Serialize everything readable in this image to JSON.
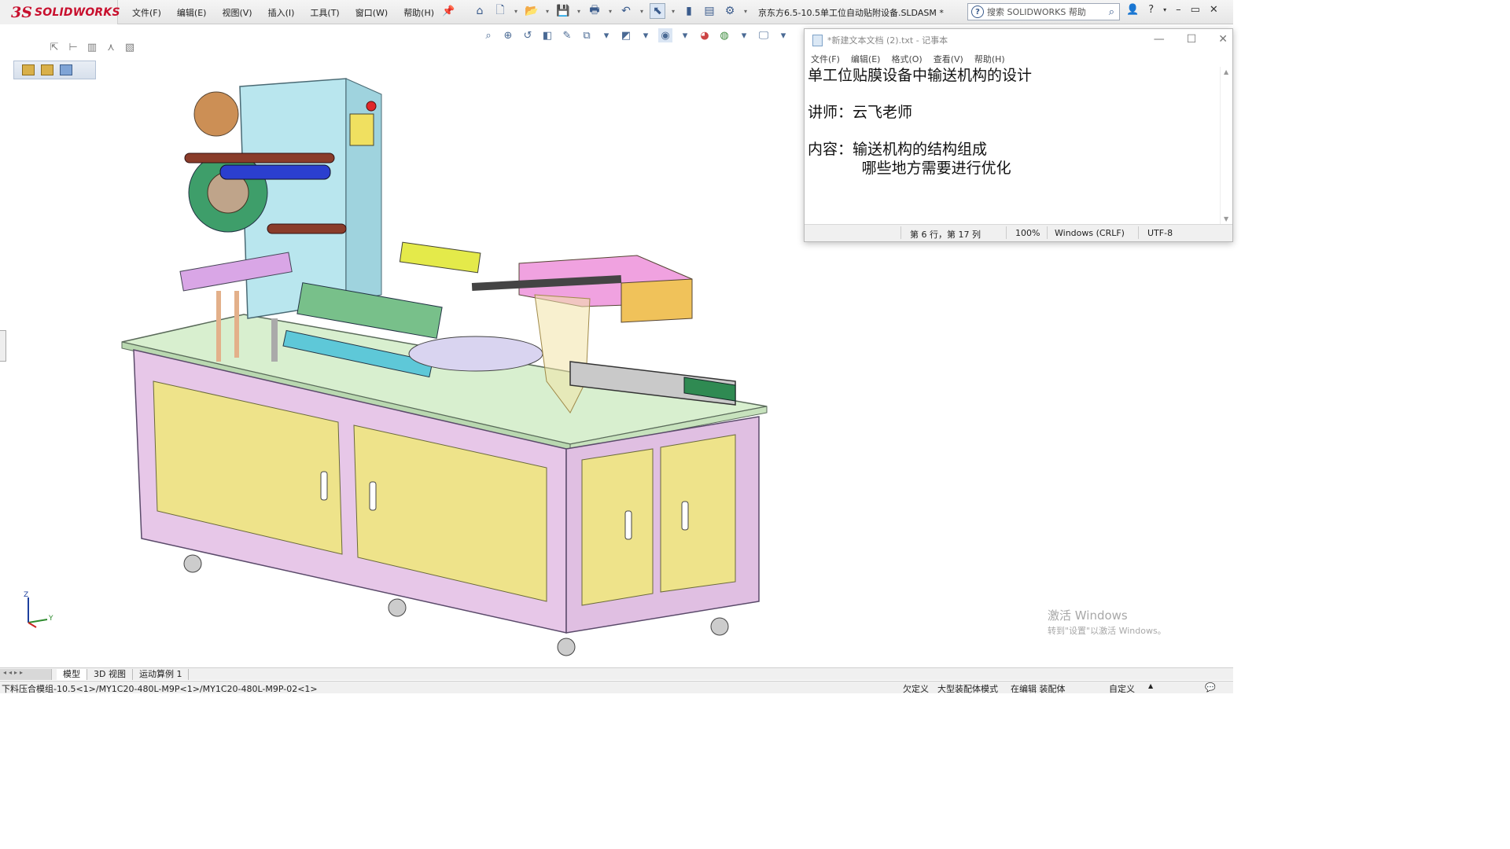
{
  "app": {
    "brand_ds": "3S",
    "brand_name": "SOLIDWORKS",
    "document_title": "京东方6.5-10.5单工位自动贴附设备.SLDASM *"
  },
  "menu": [
    "文件(F)",
    "编辑(E)",
    "视图(V)",
    "插入(I)",
    "工具(T)",
    "窗口(W)",
    "帮助(H)"
  ],
  "search": {
    "placeholder": "搜索 SOLIDWORKS 帮助"
  },
  "toolbar": {
    "icons": [
      "home-icon",
      "new-document-icon",
      "open-icon",
      "save-icon",
      "print-icon",
      "undo-icon",
      "select-icon",
      "rebuild-icon",
      "file-properties-icon",
      "options-icon"
    ]
  },
  "heads_up_toolbar": {
    "icons": [
      "zoom-to-fit-icon",
      "zoom-area-icon",
      "previous-view-icon",
      "section-view-icon",
      "dynamic-annotation-icon",
      "view-orientation-icon",
      "display-style-icon",
      "hide-show-icon",
      "edit-appearance-icon",
      "apply-scene-icon",
      "view-settings-icon"
    ]
  },
  "notepad": {
    "title": "*新建文本文档 (2).txt - 记事本",
    "menu": [
      "文件(F)",
      "编辑(E)",
      "格式(O)",
      "查看(V)",
      "帮助(H)"
    ],
    "lines": [
      "单工位贴膜设备中输送机构的设计",
      "",
      "讲师：云飞老师",
      "",
      "内容：输送机构的结构组成",
      "      哪些地方需要进行优化"
    ],
    "status": {
      "position": "第 6 行，第 17 列",
      "zoom": "100%",
      "line_ending": "Windows (CRLF)",
      "encoding": "UTF-8"
    }
  },
  "watermark": {
    "line1": "激活 Windows",
    "line2": "转到\"设置\"以激活 Windows。"
  },
  "bottom_tabs": [
    "模型",
    "3D 视图",
    "运动算例 1"
  ],
  "status_bar": {
    "path": "下料压合模组-10.5<1>/MY1C20-480L-M9P<1>/MY1C20-480L-M9P-02<1>",
    "items": [
      "欠定义",
      "大型装配体模式",
      "在编辑 装配体",
      "自定义"
    ]
  },
  "triad": {
    "z": "Z",
    "y": "Y"
  }
}
